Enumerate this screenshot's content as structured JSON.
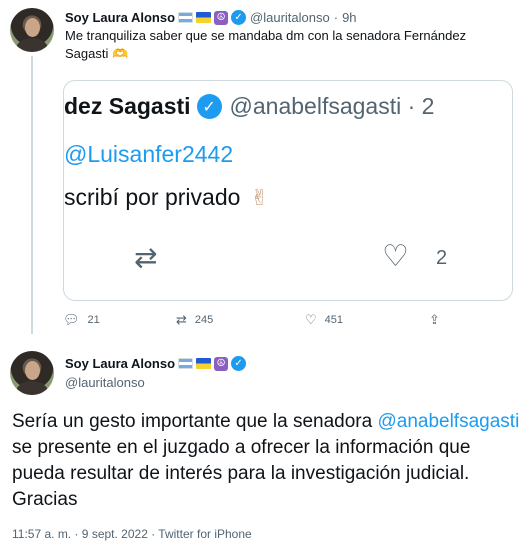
{
  "tweet1": {
    "author_name": "Soy Laura Alonso",
    "handle": "@lauritalonso",
    "time": "9h",
    "separator": "·",
    "text": "Me tranquiliza saber que se mandaba dm con la senadora Fernández Sagasti 🫶",
    "quoted": {
      "name_fragment": "dez Sagasti",
      "handle_fragment": "@anabelfsagasti · 2",
      "mention": "@Luisanfer2442",
      "text_fragment": "scribí por privado",
      "emoji": "✌",
      "like_count": "2"
    },
    "actions": {
      "replies": "21",
      "retweets": "245",
      "likes": "451"
    }
  },
  "tweet2": {
    "author_name": "Soy Laura Alonso",
    "handle": "@lauritalonso",
    "text_before": "Sería un gesto importante que la senadora ",
    "mention": "@anabelfsagasti",
    "text_after": " se presente en el juzgado a ofrecer la información que pueda resultar de interés para la investigación judicial. Gracias",
    "meta": "11:57 a. m. · 9 sept. 2022 · Twitter for iPhone"
  },
  "icons": {
    "reply": "reply-icon",
    "retweet": "retweet-icon",
    "like": "heart-icon",
    "share": "share-icon",
    "verified": "verified-badge-icon",
    "flag_argentina": "argentina-flag-icon",
    "flag_ukraine": "ukraine-flag-icon",
    "peace": "peace-symbol-icon"
  },
  "colors": {
    "accent": "#1d9bf0",
    "secondary_text": "#536471",
    "border": "#cfd9de"
  }
}
